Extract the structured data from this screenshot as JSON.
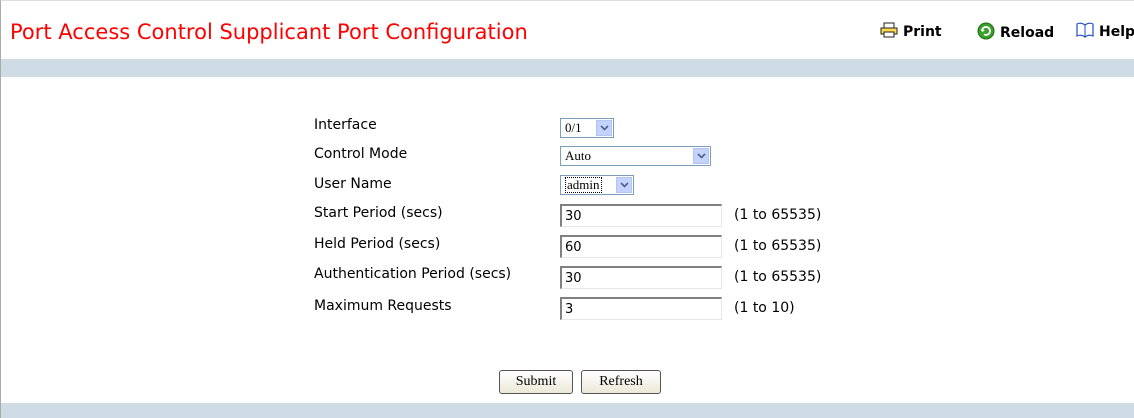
{
  "page": {
    "title": "Port Access Control Supplicant Port Configuration"
  },
  "toolbar": {
    "print": "Print",
    "reload": "Reload",
    "help": "Help"
  },
  "form": {
    "interface": {
      "label": "Interface",
      "value": "0/1"
    },
    "control_mode": {
      "label": "Control Mode",
      "value": "Auto"
    },
    "user_name": {
      "label": "User Name",
      "value": "admin"
    },
    "start_period": {
      "label": "Start Period (secs)",
      "value": "30",
      "range": "(1 to 65535)"
    },
    "held_period": {
      "label": "Held Period (secs)",
      "value": "60",
      "range": "(1 to 65535)"
    },
    "auth_period": {
      "label": "Authentication Period (secs)",
      "value": "30",
      "range": "(1 to 65535)"
    },
    "max_requests": {
      "label": "Maximum Requests",
      "value": "3",
      "range": "(1 to 10)"
    }
  },
  "buttons": {
    "submit": "Submit",
    "refresh": "Refresh"
  },
  "colors": {
    "title": "#ff0000",
    "band": "#cfdbe5",
    "reload_icon": "#3aa02a"
  }
}
